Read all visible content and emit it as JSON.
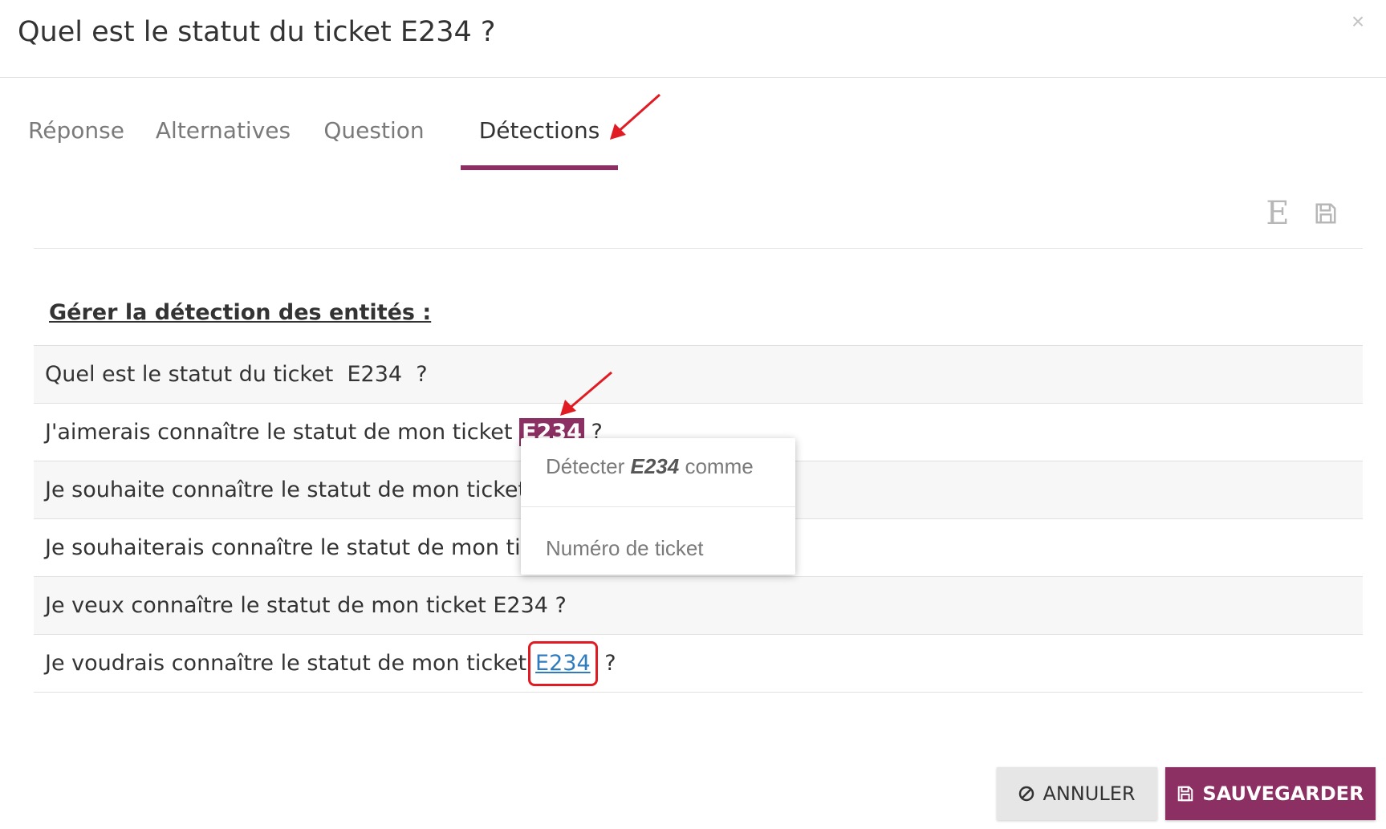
{
  "dialog": {
    "title": "Quel est le statut du ticket E234 ?",
    "close_icon": "×"
  },
  "tabs": [
    {
      "label": "Réponse",
      "active": false
    },
    {
      "label": "Alternatives",
      "active": false
    },
    {
      "label": "Question",
      "active": false
    },
    {
      "label": "Détections",
      "active": true
    }
  ],
  "toolbar": {
    "entity_icon": "E",
    "save_icon": "floppy-disk-icon"
  },
  "section": {
    "title": "Gérer la détection des entités :"
  },
  "rows": [
    {
      "before": "Quel est le statut du ticket  ",
      "entity": "E234",
      "after": "  ?"
    },
    {
      "before": "J'aimerais connaître le statut de mon ticket ",
      "entity": "E234",
      "after": " ?"
    },
    {
      "before": "Je souhaite connaître le statut de mon ticket E234 ?",
      "entity": "",
      "after": ""
    },
    {
      "before": "Je souhaiterais connaître le statut de mon ticket E234 ?",
      "entity": "",
      "after": ""
    },
    {
      "before": "Je veux connaître le statut de mon ticket E234 ?",
      "entity": "",
      "after": ""
    },
    {
      "before": "Je voudrais connaître le statut de mon ticket",
      "entity": "E234",
      "after": " ?"
    }
  ],
  "popup": {
    "prefix": "Détecter ",
    "entity": "E234",
    "suffix": " comme",
    "option": "Numéro de ticket"
  },
  "footer": {
    "cancel_label": "ANNULER",
    "save_label": "SAUVEGARDER"
  },
  "colors": {
    "accent": "#8c2f62",
    "link": "#2f7bbf",
    "annotation": "#e01b24"
  }
}
